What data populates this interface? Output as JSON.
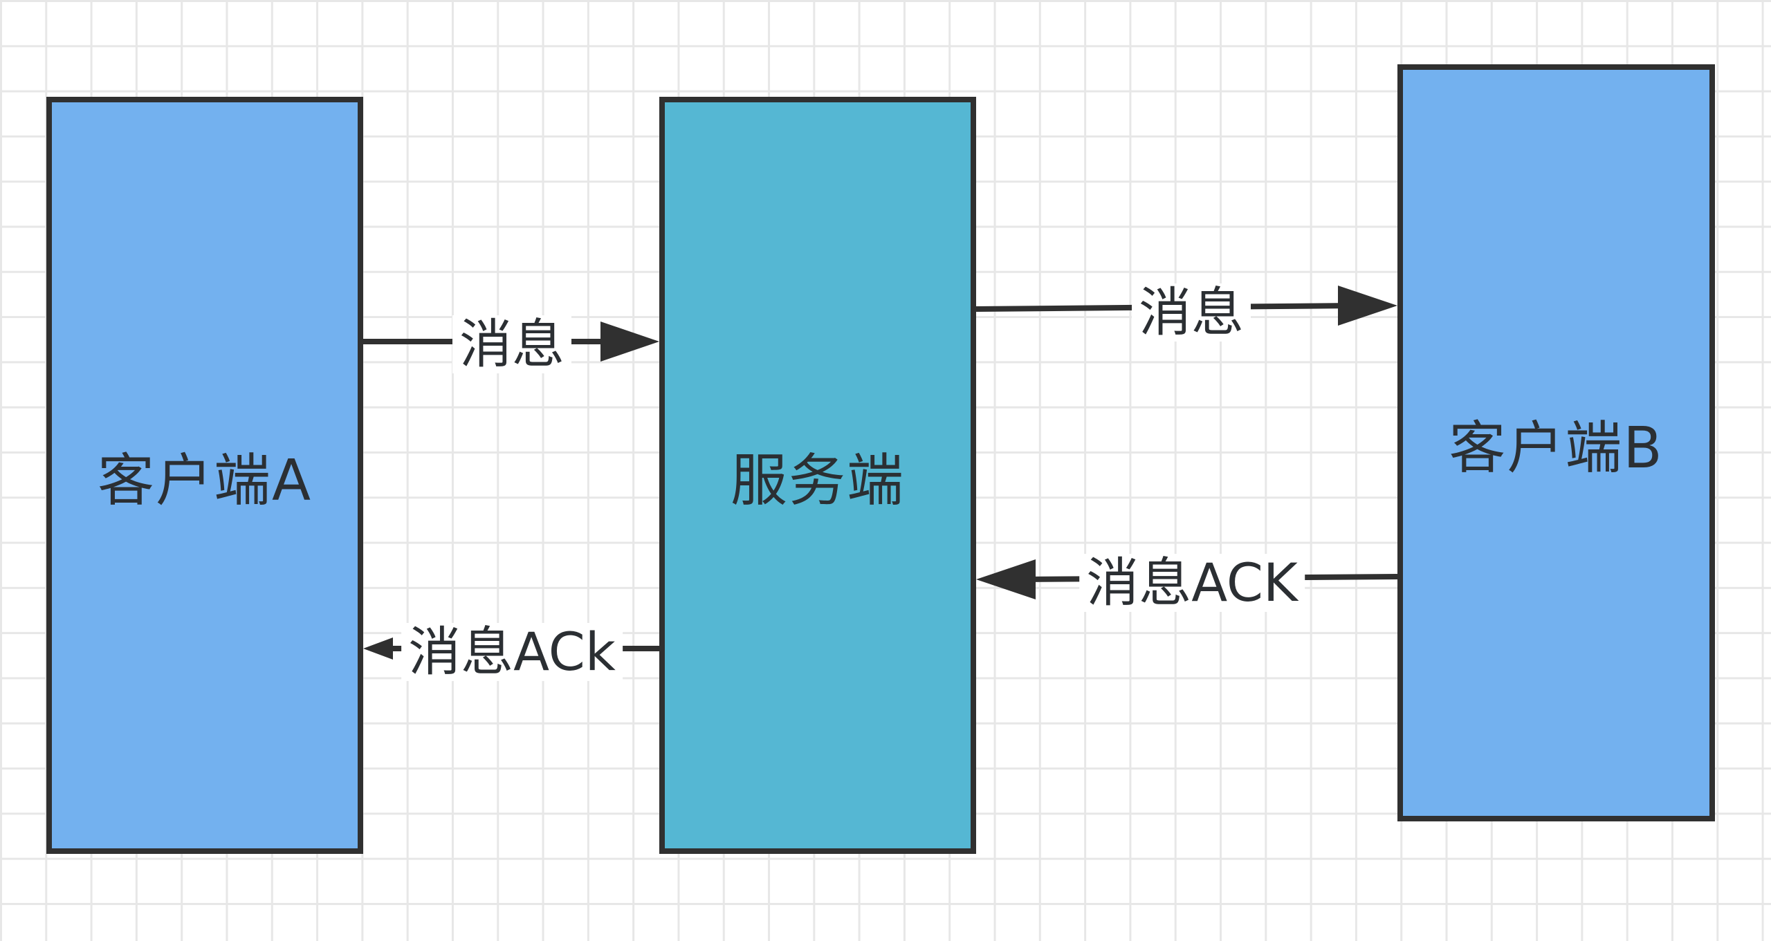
{
  "nodes": {
    "client_a": {
      "label": "客户端A",
      "fill": "#73b1ef"
    },
    "server": {
      "label": "服务端",
      "fill": "#55b7d3"
    },
    "client_b": {
      "label": "客户端B",
      "fill": "#73b1ef"
    }
  },
  "edges": [
    {
      "from": "client_a",
      "to": "server",
      "label": "消息"
    },
    {
      "from": "server",
      "to": "client_b",
      "label": "消息"
    },
    {
      "from": "client_b",
      "to": "server",
      "label": "消息ACK"
    },
    {
      "from": "server",
      "to": "client_a",
      "label": "消息ACk"
    }
  ],
  "colors": {
    "grid": "#e7e7e7",
    "stroke": "#303030",
    "text": "#2b2f33"
  }
}
